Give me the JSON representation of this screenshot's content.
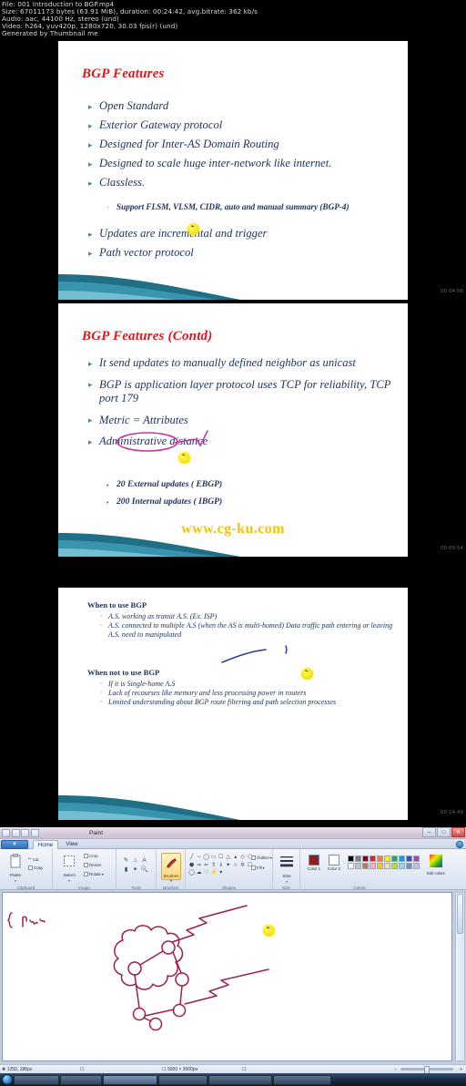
{
  "meta": {
    "line1": "File: 001 Introduction to BGP.mp4",
    "line2": "Size: 67011173 bytes (63.91 MiB), duration: 00:24:42, avg.bitrate: 362 kb/s",
    "line3": "Audio: aac, 44100 Hz, stereo (und)",
    "line4": "Video: h264, yuv420p, 1280x720, 30.03 fps(r) (und)",
    "line5": "Generated by Thumbnail me"
  },
  "slides": [
    {
      "timestamp": "00:04:56",
      "title": "BGP Features",
      "bullets": [
        "Open Standard",
        "Exterior Gateway protocol",
        "Designed for Inter-AS Domain Routing",
        "Designed to scale huge inter-network like internet.",
        "Classless."
      ],
      "sub": [
        "Support FLSM, VLSM, CIDR, auto and manual  summary (BGP-4)"
      ],
      "bullets2": [
        "Updates are incremental and trigger",
        "Path vector protocol"
      ]
    },
    {
      "timestamp": "00:09:54",
      "title": "BGP Features (Contd)",
      "bullets": [
        "It send updates to manually defined neighbor as unicast",
        " BGP is application layer protocol uses TCP for reliability,  TCP port 179",
        "Metric = Attributes",
        "Administrative distance"
      ],
      "sub": [
        "20 External updates ( EBGP)",
        "200 Internal updates   ( IBGP)"
      ],
      "watermark": "www.cg-ku.com"
    },
    {
      "timestamp": "00:14:49",
      "head1": "When to use BGP",
      "list1": [
        "A.S. working as transit A.S. (Ex. ISP)",
        "A.S. connected to multiple A.S (when the AS is multi-homed) Data traffic path entering or leaving A.S. need to  manipulated"
      ],
      "head2": "When not to use BGP",
      "list2": [
        "If it is Single-home A.S",
        "Lack of recourses like memory and less processing  power in routers",
        "Limited understanding  about BGP route filtering and  path selection processes"
      ]
    }
  ],
  "paint": {
    "window_title": "Paint",
    "app_button": "▼",
    "tabs": [
      {
        "label": "Home",
        "active": true
      },
      {
        "label": "View",
        "active": false
      }
    ],
    "window_controls": [
      "–",
      "□",
      "✕"
    ],
    "groups": [
      {
        "name": "Clipboard",
        "big": {
          "label": "Paste",
          "icon": "paste-icon"
        },
        "small": [
          {
            "label": "Cut",
            "icon": "cut-icon"
          },
          {
            "label": "Copy",
            "icon": "copy-icon"
          }
        ]
      },
      {
        "name": "Image",
        "big": {
          "label": "Select",
          "icon": "select-icon"
        },
        "small": [
          {
            "label": "Crop",
            "icon": "crop-icon"
          },
          {
            "label": "Resize",
            "icon": "resize-icon"
          },
          {
            "label": "Rotate",
            "icon": "rotate-icon"
          }
        ]
      },
      {
        "name": "Tools"
      },
      {
        "name": "Brushes",
        "big": {
          "label": "Brushes",
          "icon": "brush-icon"
        }
      },
      {
        "name": "Shapes"
      },
      {
        "name": "Size",
        "big": {
          "label": "Size",
          "icon": "size-icon"
        }
      },
      {
        "name": "Colors"
      }
    ],
    "tool_icons": [
      "pencil-icon",
      "fill-icon",
      "text-icon",
      "eraser-icon",
      "colorpicker-icon",
      "magnifier-icon"
    ],
    "shape_icons": [
      "line",
      "curve",
      "oval",
      "rectangle",
      "rounded-rectangle",
      "triangle",
      "right-triangle",
      "diamond",
      "pentagon",
      "hexagon",
      "right-arrow",
      "left-arrow",
      "up-arrow",
      "down-arrow",
      "four-point-star",
      "five-point-star",
      "six-point-star",
      "rounded-callout",
      "oval-callout",
      "cloud-callout",
      "heart",
      "lightning"
    ],
    "shape_options": [
      {
        "label": "Outline",
        "icon": "outline-icon"
      },
      {
        "label": "Fill",
        "icon": "fill-bucket-icon"
      }
    ],
    "color1": {
      "label": "Color 1",
      "hex": "#8c1f1f"
    },
    "color2": {
      "label": "Color 2",
      "hex": "#ffffff"
    },
    "palette_row1": [
      "#000000",
      "#7f7f7f",
      "#880015",
      "#ed1c24",
      "#ff7f27",
      "#fff200",
      "#22b14c",
      "#00a2e8",
      "#3f48cc",
      "#a349a4"
    ],
    "palette_row2": [
      "#ffffff",
      "#c3c3c3",
      "#b97a57",
      "#ffaec9",
      "#ffc90e",
      "#efe4b0",
      "#b5e61d",
      "#99d9ea",
      "#7092be",
      "#c8bfe7"
    ],
    "edit_colors": {
      "label": "Edit colors",
      "icon": "edit-colors-icon"
    },
    "help_icon": "help-icon",
    "status": {
      "cursor_pos": "1250, 188px",
      "selection_size": "",
      "canvas_size": "5000 × 3000px",
      "zoom_level": "100%"
    },
    "canvas_note": "Intr"
  },
  "taskbar": {
    "start_icon": "windows-start-orb",
    "items": [
      "",
      "",
      "",
      "",
      "",
      ""
    ],
    "clock": ""
  },
  "colors": {
    "slide_title": "#d41b20",
    "slide_text": "#21355e",
    "bullet": "#3f8fa3",
    "teal": "#1f6f86",
    "watermark": "#f4c20d",
    "ink_magenta": "#cc33aa",
    "ink_blue": "#2b3b9e",
    "ink_maroon": "#9e1f4a"
  }
}
